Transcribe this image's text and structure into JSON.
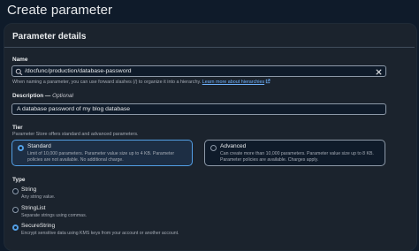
{
  "page": {
    "title": "Create parameter"
  },
  "panel": {
    "header": "Parameter details"
  },
  "name_field": {
    "label": "Name",
    "value": "/docfunc/production/database-password",
    "hint": "When naming a parameter, you can use forward slashes (/) to organize it into a hierarchy.",
    "hint_link": "Learn more about hierarchies"
  },
  "description_field": {
    "label": "Description —",
    "optional": "Optional",
    "value": "A database password of my blog database"
  },
  "tier": {
    "label": "Tier",
    "hint": "Parameter Store offers standard and advanced parameters.",
    "options": [
      {
        "title": "Standard",
        "description": "Limit of 10,000 parameters. Parameter value size up to 4 KB. Parameter policies are not available. No additional charge.",
        "selected": true
      },
      {
        "title": "Advanced",
        "description": "Can create more than 10,000 parameters. Parameter value size up to 8 KB. Parameter policies are available. Charges apply.",
        "selected": false
      }
    ]
  },
  "type": {
    "label": "Type",
    "options": [
      {
        "title": "String",
        "description": "Any string value.",
        "selected": false
      },
      {
        "title": "StringList",
        "description": "Separate strings using commas.",
        "selected": false
      },
      {
        "title": "SecureString",
        "description": "Encrypt sensitive data using KMS keys from your account or another account.",
        "selected": true
      }
    ]
  },
  "colors": {
    "accent": "#539fe5",
    "background": "#0f1b2a",
    "panel": "#1b232d"
  },
  "icons": {
    "search": "search-icon",
    "clear": "close-icon",
    "external": "external-link-icon"
  }
}
